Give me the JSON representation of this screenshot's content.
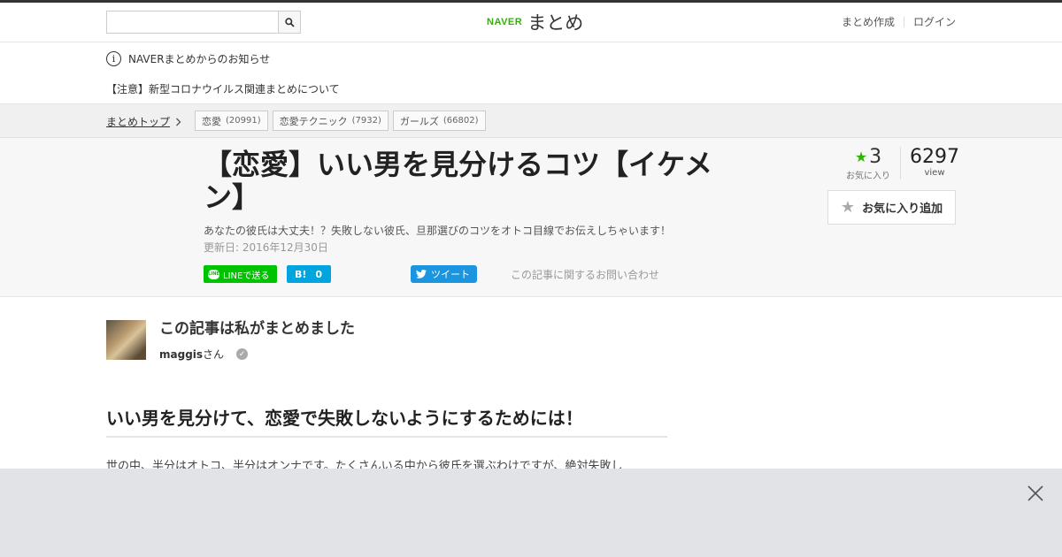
{
  "header": {
    "search": {
      "placeholder": "",
      "value": "",
      "button_icon": "search-icon"
    },
    "logo": {
      "brand": "NAVER",
      "name": "まとめ"
    },
    "links": [
      "まとめ作成",
      "ログイン"
    ]
  },
  "notice": {
    "title": "NAVERまとめからのお知らせ",
    "item": "【注意】新型コロナウイルス関連まとめについて"
  },
  "breadcrumb": {
    "top": "まとめトップ",
    "tags": [
      {
        "label": "恋愛",
        "count": "(20991)"
      },
      {
        "label": "恋愛テクニック",
        "count": "(7932)"
      },
      {
        "label": "ガールズ",
        "count": "(66802)"
      }
    ]
  },
  "article": {
    "title": "【恋愛】いい男を見分けるコツ【イケメン】",
    "description": "あなたの彼氏は大丈夫！？失敗しない彼氏、旦那選びのコツをオトコ目線でお伝えしちゃいます！",
    "updated": "更新日: 2016年12月30日",
    "share": {
      "line": "LINEで送る",
      "hatena_count": "0",
      "tweet": "ツイート",
      "inquiry": "この記事に関するお問い合わせ"
    },
    "stats": {
      "favorites": "3",
      "favorites_label": "お気に入り",
      "views": "6297",
      "views_label": "view"
    },
    "fav_button": "お気に入り追加"
  },
  "author": {
    "heading": "この記事は私がまとめました",
    "name": "maggis",
    "suffix": "さん"
  },
  "content": {
    "section_title": "いい男を見分けて、恋愛で失敗しないようにするためには！",
    "text": "世の中、半分はオトコ、半分はオンナです。たくさんいる中から彼氏を選ぶわけですが、絶対失敗し"
  },
  "colors": {
    "brand_green": "#2db400",
    "line_green": "#00c300",
    "hatena_blue": "#00a4de",
    "twitter_blue": "#1b95e0"
  }
}
